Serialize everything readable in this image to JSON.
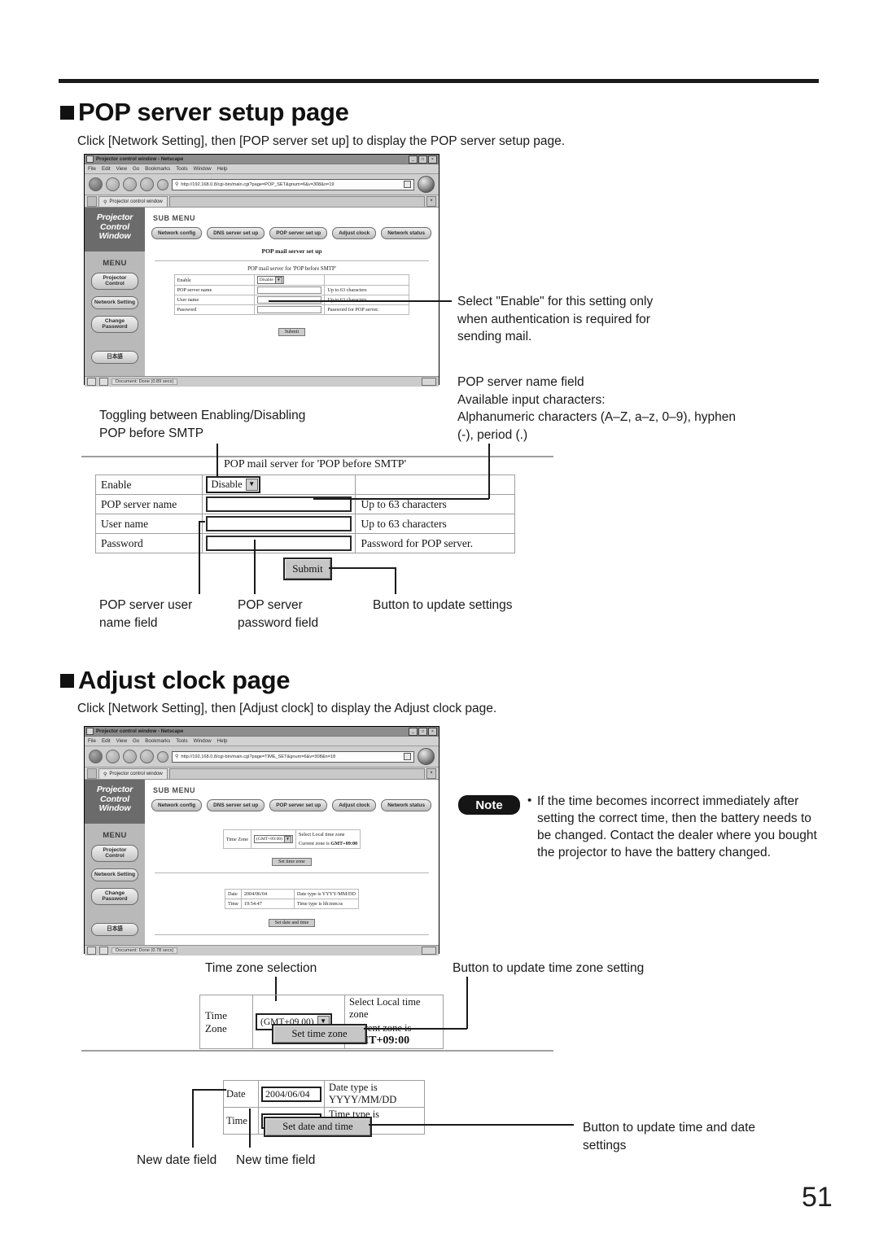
{
  "page": {
    "number": "51"
  },
  "section1": {
    "heading": "POP server setup page",
    "intro": "Click [Network Setting], then [POP server set up] to display the POP server setup page.",
    "browser": {
      "title": "Projector control window - Netscape",
      "menu": [
        "File",
        "Edit",
        "View",
        "Go",
        "Bookmarks",
        "Tools",
        "Window",
        "Help"
      ],
      "url": "http://192.168.0.8/cgi-bin/main.cgi?page=POP_SET&gnum=6&v=308&n=19",
      "tab_label": "Projector control window",
      "brand": "Projector Control Window",
      "sub_menu_title": "SUB MENU",
      "nav_buttons": [
        "Network config",
        "DNS server set up",
        "POP server set up",
        "Adjust clock",
        "Network status"
      ],
      "menu_title": "MENU",
      "side_buttons": [
        "Projector Control",
        "Network Setting",
        "Change Password",
        "日本語"
      ],
      "page_title": "POP mail server set up",
      "form_caption": "POP mail server for 'POP before SMTP'",
      "rows": [
        {
          "label": "Enable",
          "value": "Disable",
          "hint": ""
        },
        {
          "label": "POP server name",
          "value": "",
          "hint": "Up to 63 characters"
        },
        {
          "label": "User name",
          "value": "",
          "hint": "Up to 63 characters"
        },
        {
          "label": "Password",
          "value": "",
          "hint": "Password for POP server."
        }
      ],
      "submit_label": "Submit",
      "status": "Document: Done (0.89 secs)"
    },
    "callouts": {
      "enable": "Select \"Enable\" for this setting only\nwhen authentication is required for\nsending mail.",
      "server_name": "POP server name field\nAvailable input characters:\nAlphanumeric characters (A–Z, a–z, 0–9), hyphen\n(-), period (.)",
      "toggle": "Toggling between Enabling/Disabling\nPOP before SMTP",
      "user_name": "POP server user\nname field",
      "password": "POP server\npassword field",
      "submit": "Button to update settings"
    },
    "detail": {
      "caption": "POP mail server for 'POP before SMTP'",
      "rows": [
        {
          "label": "Enable",
          "value": "Disable",
          "hint": ""
        },
        {
          "label": "POP server name",
          "value": "",
          "hint": "Up to 63 characters"
        },
        {
          "label": "User name",
          "value": "",
          "hint": "Up to 63 characters"
        },
        {
          "label": "Password",
          "value": "",
          "hint": "Password for POP server."
        }
      ],
      "submit_label": "Submit"
    }
  },
  "section2": {
    "heading": "Adjust clock page",
    "intro": "Click [Network Setting], then [Adjust clock] to display the Adjust clock page.",
    "browser": {
      "title": "Projector control window - Netscape",
      "menu": [
        "File",
        "Edit",
        "View",
        "Go",
        "Bookmarks",
        "Tools",
        "Window",
        "Help"
      ],
      "url": "http://192.168.0.8/cgi-bin/main.cgi?page=TIME_SET&gnum=6&v=308&n=18",
      "tab_label": "Projector control window",
      "brand": "Projector Control Window",
      "sub_menu_title": "SUB MENU",
      "nav_buttons": [
        "Network config",
        "DNS server set up",
        "POP server set up",
        "Adjust clock",
        "Network status"
      ],
      "menu_title": "MENU",
      "side_buttons": [
        "Projector Control",
        "Network Setting",
        "Change Password",
        "日本語"
      ],
      "timezone": {
        "label": "Time Zone",
        "value": "(GMT+09:00)",
        "hint_line1": "Select Local time zone",
        "hint_line2_prefix": "Current zone is ",
        "hint_line2_value": "GMT+09:00",
        "button": "Set time zone"
      },
      "datetime": {
        "date_label": "Date",
        "date_value": "2004/06/04",
        "date_hint": "Date type is YYYY/MM/DD",
        "time_label": "Time",
        "time_value": "19:54:47",
        "time_hint": "Time type is hh:mm:ss",
        "button": "Set date and time"
      },
      "status": "Document: Done (0.78 secs)"
    },
    "note": {
      "badge": "Note",
      "bullet": "•",
      "text": "If the time becomes incorrect immediately after setting the correct time, then the battery needs to be changed. Contact the dealer where you bought the projector to have the battery changed."
    },
    "callouts": {
      "timezone_select": "Time zone selection",
      "timezone_button": "Button to update time zone setting",
      "new_date": "New date field",
      "new_time": "New time field",
      "datetime_button": "Button to update time and date\nsettings"
    },
    "detail_timezone": {
      "label": "Time Zone",
      "value": "(GMT+09 00)",
      "hint_line1": "Select Local time zone",
      "hint_line2_prefix": "Current zone is ",
      "hint_line2_value": "GMT+09:00",
      "button": "Set time zone"
    },
    "detail_datetime": {
      "date_label": "Date",
      "date_value": "2004/06/04",
      "date_hint": "Date type is YYYY/MM/DD",
      "time_label": "Time",
      "time_value": "19:54:47",
      "time_hint": "Time type is hh:mm:ss",
      "button": "Set date and time"
    }
  }
}
